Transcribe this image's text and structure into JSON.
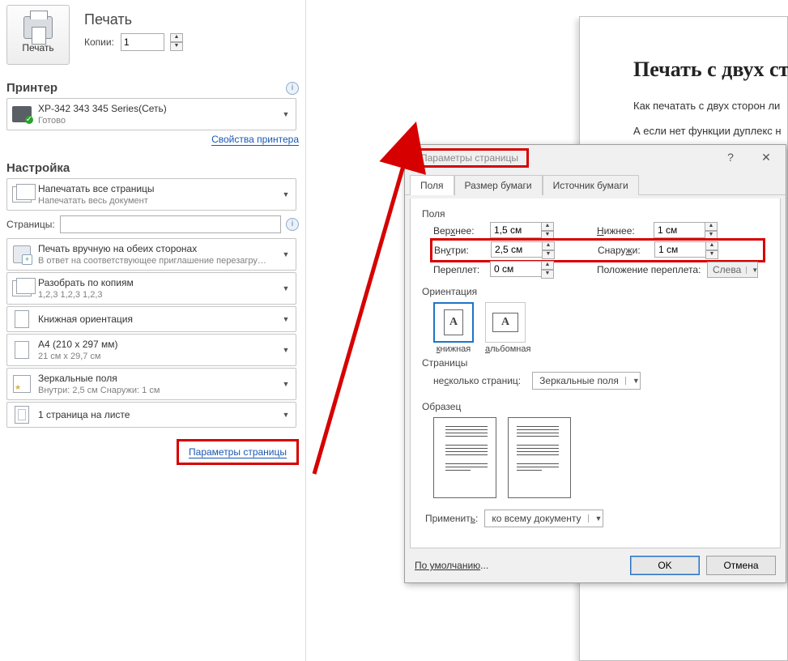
{
  "print_panel": {
    "section_print": "Печать",
    "print_btn": "Печать",
    "copies_label": "Копии:",
    "copies_value": "1",
    "printer_section": "Принтер",
    "printer_name": "XP-342 343 345 Series(Сеть)",
    "printer_status": "Готово",
    "printer_props_link": "Свойства принтера",
    "settings_section": "Настройка",
    "dd_all_pages_title": "Напечатать все страницы",
    "dd_all_pages_sub": "Напечатать весь документ",
    "pages_label": "Страницы:",
    "dd_manual_title": "Печать вручную на обеих сторонах",
    "dd_manual_sub": "В ответ на соответствующее приглашение перезагру…",
    "dd_collate_title": "Разобрать по копиям",
    "dd_collate_sub": "1,2,3    1,2,3    1,2,3",
    "dd_orientation": "Книжная ориентация",
    "dd_paper_title": "A4 (210 x 297 мм)",
    "dd_paper_sub": "21 см x 29,7 см",
    "dd_margins_title": "Зеркальные поля",
    "dd_margins_sub": "Внутри:  2,5 см   Снаружи:  1 см",
    "dd_sheets": "1 страница на листе",
    "page_setup_link": "Параметры страницы"
  },
  "doc": {
    "title": "Печать с двух ст",
    "line1": "Как печатать с двух сторон ли",
    "line2": "А если нет функции дуплекс н"
  },
  "dialog": {
    "title": "Параметры страницы",
    "tab_fields": "Поля",
    "tab_paper": "Размер бумаги",
    "tab_source": "Источник бумаги",
    "group_fields": "Поля",
    "top_label": "Верхнее:",
    "top_value": "1,5 см",
    "bottom_label": "Нижнее:",
    "bottom_value": "1 см",
    "inside_label": "Внутри:",
    "inside_value": "2,5 см",
    "outside_label": "Снаружи:",
    "outside_value": "1 см",
    "gutter_label": "Переплет:",
    "gutter_value": "0 см",
    "gutter_pos_label": "Положение переплета:",
    "gutter_pos_value": "Слева",
    "orient_group": "Ориентация",
    "orient_portrait": "книжная",
    "orient_landscape": "альбомная",
    "pages_group": "Страницы",
    "multi_label": "несколько страниц:",
    "multi_value": "Зеркальные поля",
    "sample_group": "Образец",
    "apply_label": "Применить:",
    "apply_value": "ко всему документу",
    "default_btn": "По умолчанию...",
    "ok_btn": "OK",
    "cancel_btn": "Отмена"
  },
  "colors": {
    "accent_red": "#d60000"
  }
}
